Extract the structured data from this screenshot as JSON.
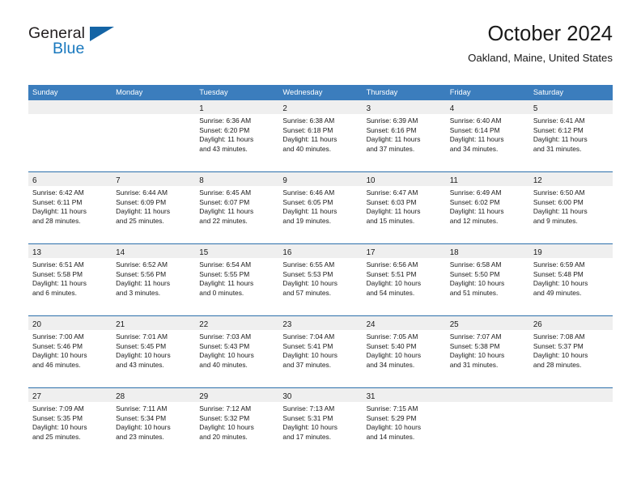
{
  "brand": {
    "name_part1": "General",
    "name_part2": "Blue",
    "triangle_icon": "triangle-icon",
    "colors": {
      "dark": "#231f20",
      "blue": "#1878be",
      "triangle": "#1464a5"
    }
  },
  "header": {
    "title": "October 2024",
    "subtitle": "Oakland, Maine, United States"
  },
  "theme": {
    "header_blue": "#3b7dbd",
    "row_divider_blue": "#2c6fab",
    "day_band_gray": "#efefef",
    "text": "#1a1a1a"
  },
  "weekdays": [
    "Sunday",
    "Monday",
    "Tuesday",
    "Wednesday",
    "Thursday",
    "Friday",
    "Saturday"
  ],
  "weeks": [
    [
      {
        "day": "",
        "lines": []
      },
      {
        "day": "",
        "lines": []
      },
      {
        "day": "1",
        "lines": [
          "Sunrise: 6:36 AM",
          "Sunset: 6:20 PM",
          "Daylight: 11 hours",
          "and 43 minutes."
        ]
      },
      {
        "day": "2",
        "lines": [
          "Sunrise: 6:38 AM",
          "Sunset: 6:18 PM",
          "Daylight: 11 hours",
          "and 40 minutes."
        ]
      },
      {
        "day": "3",
        "lines": [
          "Sunrise: 6:39 AM",
          "Sunset: 6:16 PM",
          "Daylight: 11 hours",
          "and 37 minutes."
        ]
      },
      {
        "day": "4",
        "lines": [
          "Sunrise: 6:40 AM",
          "Sunset: 6:14 PM",
          "Daylight: 11 hours",
          "and 34 minutes."
        ]
      },
      {
        "day": "5",
        "lines": [
          "Sunrise: 6:41 AM",
          "Sunset: 6:12 PM",
          "Daylight: 11 hours",
          "and 31 minutes."
        ]
      }
    ],
    [
      {
        "day": "6",
        "lines": [
          "Sunrise: 6:42 AM",
          "Sunset: 6:11 PM",
          "Daylight: 11 hours",
          "and 28 minutes."
        ]
      },
      {
        "day": "7",
        "lines": [
          "Sunrise: 6:44 AM",
          "Sunset: 6:09 PM",
          "Daylight: 11 hours",
          "and 25 minutes."
        ]
      },
      {
        "day": "8",
        "lines": [
          "Sunrise: 6:45 AM",
          "Sunset: 6:07 PM",
          "Daylight: 11 hours",
          "and 22 minutes."
        ]
      },
      {
        "day": "9",
        "lines": [
          "Sunrise: 6:46 AM",
          "Sunset: 6:05 PM",
          "Daylight: 11 hours",
          "and 19 minutes."
        ]
      },
      {
        "day": "10",
        "lines": [
          "Sunrise: 6:47 AM",
          "Sunset: 6:03 PM",
          "Daylight: 11 hours",
          "and 15 minutes."
        ]
      },
      {
        "day": "11",
        "lines": [
          "Sunrise: 6:49 AM",
          "Sunset: 6:02 PM",
          "Daylight: 11 hours",
          "and 12 minutes."
        ]
      },
      {
        "day": "12",
        "lines": [
          "Sunrise: 6:50 AM",
          "Sunset: 6:00 PM",
          "Daylight: 11 hours",
          "and 9 minutes."
        ]
      }
    ],
    [
      {
        "day": "13",
        "lines": [
          "Sunrise: 6:51 AM",
          "Sunset: 5:58 PM",
          "Daylight: 11 hours",
          "and 6 minutes."
        ]
      },
      {
        "day": "14",
        "lines": [
          "Sunrise: 6:52 AM",
          "Sunset: 5:56 PM",
          "Daylight: 11 hours",
          "and 3 minutes."
        ]
      },
      {
        "day": "15",
        "lines": [
          "Sunrise: 6:54 AM",
          "Sunset: 5:55 PM",
          "Daylight: 11 hours",
          "and 0 minutes."
        ]
      },
      {
        "day": "16",
        "lines": [
          "Sunrise: 6:55 AM",
          "Sunset: 5:53 PM",
          "Daylight: 10 hours",
          "and 57 minutes."
        ]
      },
      {
        "day": "17",
        "lines": [
          "Sunrise: 6:56 AM",
          "Sunset: 5:51 PM",
          "Daylight: 10 hours",
          "and 54 minutes."
        ]
      },
      {
        "day": "18",
        "lines": [
          "Sunrise: 6:58 AM",
          "Sunset: 5:50 PM",
          "Daylight: 10 hours",
          "and 51 minutes."
        ]
      },
      {
        "day": "19",
        "lines": [
          "Sunrise: 6:59 AM",
          "Sunset: 5:48 PM",
          "Daylight: 10 hours",
          "and 49 minutes."
        ]
      }
    ],
    [
      {
        "day": "20",
        "lines": [
          "Sunrise: 7:00 AM",
          "Sunset: 5:46 PM",
          "Daylight: 10 hours",
          "and 46 minutes."
        ]
      },
      {
        "day": "21",
        "lines": [
          "Sunrise: 7:01 AM",
          "Sunset: 5:45 PM",
          "Daylight: 10 hours",
          "and 43 minutes."
        ]
      },
      {
        "day": "22",
        "lines": [
          "Sunrise: 7:03 AM",
          "Sunset: 5:43 PM",
          "Daylight: 10 hours",
          "and 40 minutes."
        ]
      },
      {
        "day": "23",
        "lines": [
          "Sunrise: 7:04 AM",
          "Sunset: 5:41 PM",
          "Daylight: 10 hours",
          "and 37 minutes."
        ]
      },
      {
        "day": "24",
        "lines": [
          "Sunrise: 7:05 AM",
          "Sunset: 5:40 PM",
          "Daylight: 10 hours",
          "and 34 minutes."
        ]
      },
      {
        "day": "25",
        "lines": [
          "Sunrise: 7:07 AM",
          "Sunset: 5:38 PM",
          "Daylight: 10 hours",
          "and 31 minutes."
        ]
      },
      {
        "day": "26",
        "lines": [
          "Sunrise: 7:08 AM",
          "Sunset: 5:37 PM",
          "Daylight: 10 hours",
          "and 28 minutes."
        ]
      }
    ],
    [
      {
        "day": "27",
        "lines": [
          "Sunrise: 7:09 AM",
          "Sunset: 5:35 PM",
          "Daylight: 10 hours",
          "and 25 minutes."
        ]
      },
      {
        "day": "28",
        "lines": [
          "Sunrise: 7:11 AM",
          "Sunset: 5:34 PM",
          "Daylight: 10 hours",
          "and 23 minutes."
        ]
      },
      {
        "day": "29",
        "lines": [
          "Sunrise: 7:12 AM",
          "Sunset: 5:32 PM",
          "Daylight: 10 hours",
          "and 20 minutes."
        ]
      },
      {
        "day": "30",
        "lines": [
          "Sunrise: 7:13 AM",
          "Sunset: 5:31 PM",
          "Daylight: 10 hours",
          "and 17 minutes."
        ]
      },
      {
        "day": "31",
        "lines": [
          "Sunrise: 7:15 AM",
          "Sunset: 5:29 PM",
          "Daylight: 10 hours",
          "and 14 minutes."
        ]
      },
      {
        "day": "",
        "lines": []
      },
      {
        "day": "",
        "lines": []
      }
    ]
  ]
}
